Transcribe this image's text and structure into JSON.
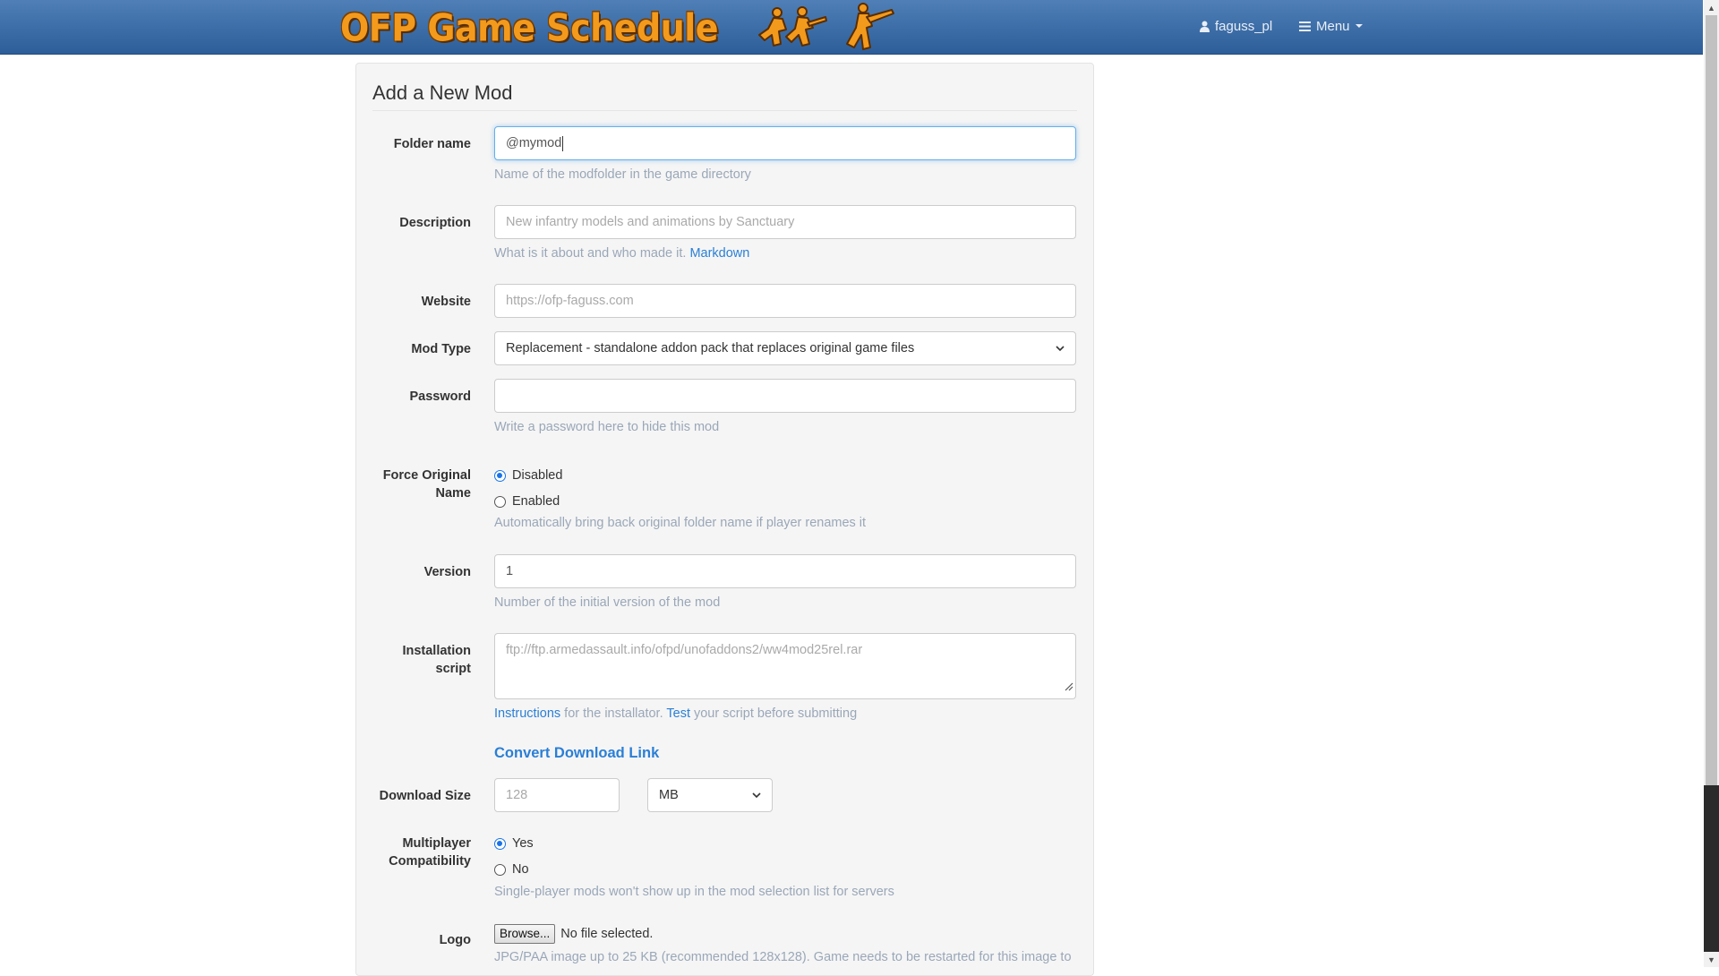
{
  "navbar": {
    "brand": "OFP Game Schedule",
    "user": "faguss_pl",
    "menu": "Menu"
  },
  "form": {
    "legend": "Add a New Mod",
    "folder": {
      "label": "Folder name",
      "value": "@mymod",
      "help": "Name of the modfolder in the game directory"
    },
    "description": {
      "label": "Description",
      "placeholder": "New infantry models and animations by Sanctuary",
      "help": "What is it about and who made it.",
      "help_link": "Markdown"
    },
    "website": {
      "label": "Website",
      "placeholder": "https://ofp-faguss.com"
    },
    "mod_type": {
      "label": "Mod Type",
      "selected": "Replacement - standalone addon pack that replaces original game files"
    },
    "password": {
      "label": "Password",
      "value": "",
      "help": "Write a password here to hide this mod"
    },
    "force_name": {
      "label_line1": "Force Original",
      "label_line2": "Name",
      "options": [
        "Disabled",
        "Enabled"
      ],
      "selected": "Disabled",
      "help": "Automatically bring back original folder name if player renames it"
    },
    "version": {
      "label": "Version",
      "value": "1",
      "help": "Number of the initial version of the mod"
    },
    "install": {
      "label_line1": "Installation",
      "label_line2": "script",
      "placeholder": "ftp://ftp.armedassault.info/ofpd/unofaddons2/ww4mod25rel.rar",
      "help_link1": "Instructions",
      "help_mid": " for the installator. ",
      "help_link2": "Test",
      "help_end": " your script before submitting"
    },
    "convert_link": "Convert Download Link",
    "download_size": {
      "label": "Download Size",
      "placeholder": "128",
      "unit": "MB"
    },
    "multiplayer": {
      "label_line1": "Multiplayer",
      "label_line2": "Compatibility",
      "options": [
        "Yes",
        "No"
      ],
      "selected": "Yes",
      "help": "Single-player mods won't show up in the mod selection list for servers"
    },
    "logo": {
      "label": "Logo",
      "browse": "Browse...",
      "file_status": "No file selected.",
      "help": "JPG/PAA image up to 25 KB (recommended 128x128). Game needs to be restarted for this image to"
    }
  },
  "colors": {
    "navbar_top": "#4f7fb6",
    "navbar_bottom": "#2e5e99",
    "brand": "#f39a1d",
    "link": "#2a7fd6",
    "help_text": "#9aa7b8",
    "radio_accent": "#1a73e8"
  }
}
